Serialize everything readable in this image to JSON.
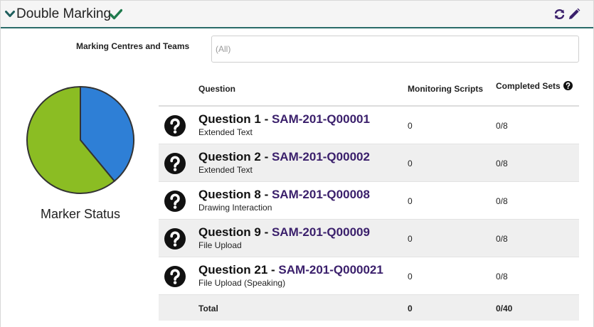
{
  "header": {
    "title": "Double Marking"
  },
  "filter": {
    "label": "Marking Centres and Teams",
    "placeholder": "(All)"
  },
  "pie": {
    "label": "Marker Status",
    "slices": [
      {
        "fraction": 0.39,
        "color": "#2e7fd6"
      },
      {
        "fraction": 0.61,
        "color": "#8bbd23"
      }
    ]
  },
  "table": {
    "headers": {
      "question": "Question",
      "monitoring": "Monitoring Scripts",
      "completed": "Completed Sets"
    },
    "rows": [
      {
        "title": "Question 1 - ",
        "code": "SAM-201-Q00001",
        "type": "Extended Text",
        "monitoring": "0",
        "completed": "0/8"
      },
      {
        "title": "Question 2 - ",
        "code": "SAM-201-Q00002",
        "type": "Extended Text",
        "monitoring": "0",
        "completed": "0/8"
      },
      {
        "title": "Question 8 - ",
        "code": "SAM-201-Q00008",
        "type": "Drawing Interaction",
        "monitoring": "0",
        "completed": "0/8"
      },
      {
        "title": "Question 9 - ",
        "code": "SAM-201-Q00009",
        "type": "File Upload",
        "monitoring": "0",
        "completed": "0/8"
      },
      {
        "title": "Question 21 - ",
        "code": "SAM-201-Q000021",
        "type": "File Upload (Speaking)",
        "monitoring": "0",
        "completed": "0/8"
      }
    ],
    "total": {
      "label": "Total",
      "monitoring": "0",
      "completed": "0/40"
    }
  },
  "colors": {
    "accent": "#2a6b69",
    "check": "#1f7a4d",
    "action_icons": "#3a1f6b",
    "question_code": "#3a1f6b"
  }
}
